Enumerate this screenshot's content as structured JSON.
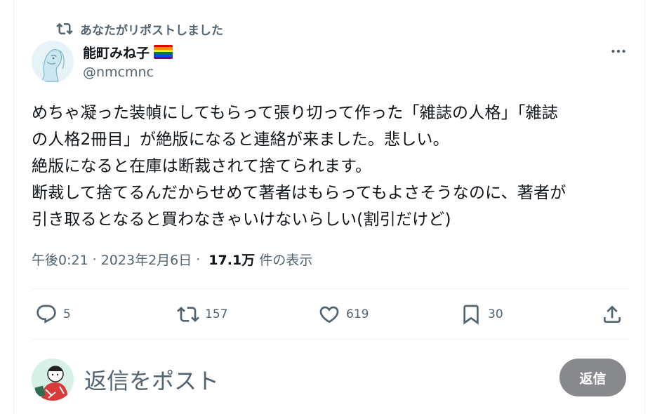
{
  "repost_banner": {
    "text": "あなたがリポストしました",
    "icon": "repost-icon"
  },
  "author": {
    "name": "能町みね子",
    "badge": "rainbow-flag-emoji",
    "handle": "@nmcmnc"
  },
  "tweet": {
    "lines": [
      "めちゃ凝った装幀にしてもらって張り切って作った「雑誌の人格」「雑誌",
      "の人格2冊目」が絶版になると連絡が来ました。悲しい。",
      "絶版になると在庫は断裁されて捨てられます。",
      "断裁して捨てるんだからせめて著者はもらってもよさそうなのに、著者が",
      "引き取るとなると買わなきゃいけないらしい(割引だけど)"
    ]
  },
  "meta": {
    "time": "午後0:21",
    "separator": "·",
    "date": "2023年2月6日",
    "views_count": "17.1万",
    "views_label": "件の表示"
  },
  "actions": {
    "reply_count": "5",
    "repost_count": "157",
    "like_count": "619",
    "bookmark_count": "30"
  },
  "reply": {
    "placeholder": "返信をポスト",
    "button_label": "返信"
  },
  "colors": {
    "text_primary": "#0f1419",
    "text_secondary": "#536471",
    "divider": "#eff3f4",
    "reply_button_bg": "#87898c"
  }
}
